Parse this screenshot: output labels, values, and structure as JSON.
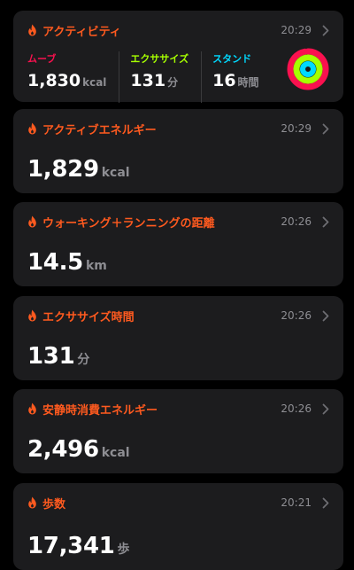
{
  "colors": {
    "accent": "#ff5a1f",
    "move": "#fa114f",
    "exercise": "#a6ff00",
    "stand": "#00d9ff",
    "card_bg": "#1c1c1e",
    "secondary_text": "#8e8e93"
  },
  "activity": {
    "title": "アクティビティ",
    "time": "20:29",
    "move": {
      "label": "ムーブ",
      "value": "1,830",
      "unit": "kcal",
      "progress": 0.97
    },
    "exercise": {
      "label": "エクササイズ",
      "value": "131",
      "unit": "分",
      "progress": 1.0
    },
    "stand": {
      "label": "スタンド",
      "value": "16",
      "unit": "時間",
      "progress": 1.0
    }
  },
  "cards": [
    {
      "title": "アクティブエネルギー",
      "time": "20:29",
      "value": "1,829",
      "unit": "kcal"
    },
    {
      "title": "ウォーキング＋ランニングの距離",
      "time": "20:26",
      "value": "14.5",
      "unit": "km"
    },
    {
      "title": "エクササイズ時間",
      "time": "20:26",
      "value": "131",
      "unit": "分"
    },
    {
      "title": "安静時消費エネルギー",
      "time": "20:26",
      "value": "2,496",
      "unit": "kcal"
    },
    {
      "title": "歩数",
      "time": "20:21",
      "value": "17,341",
      "unit": "歩"
    }
  ]
}
